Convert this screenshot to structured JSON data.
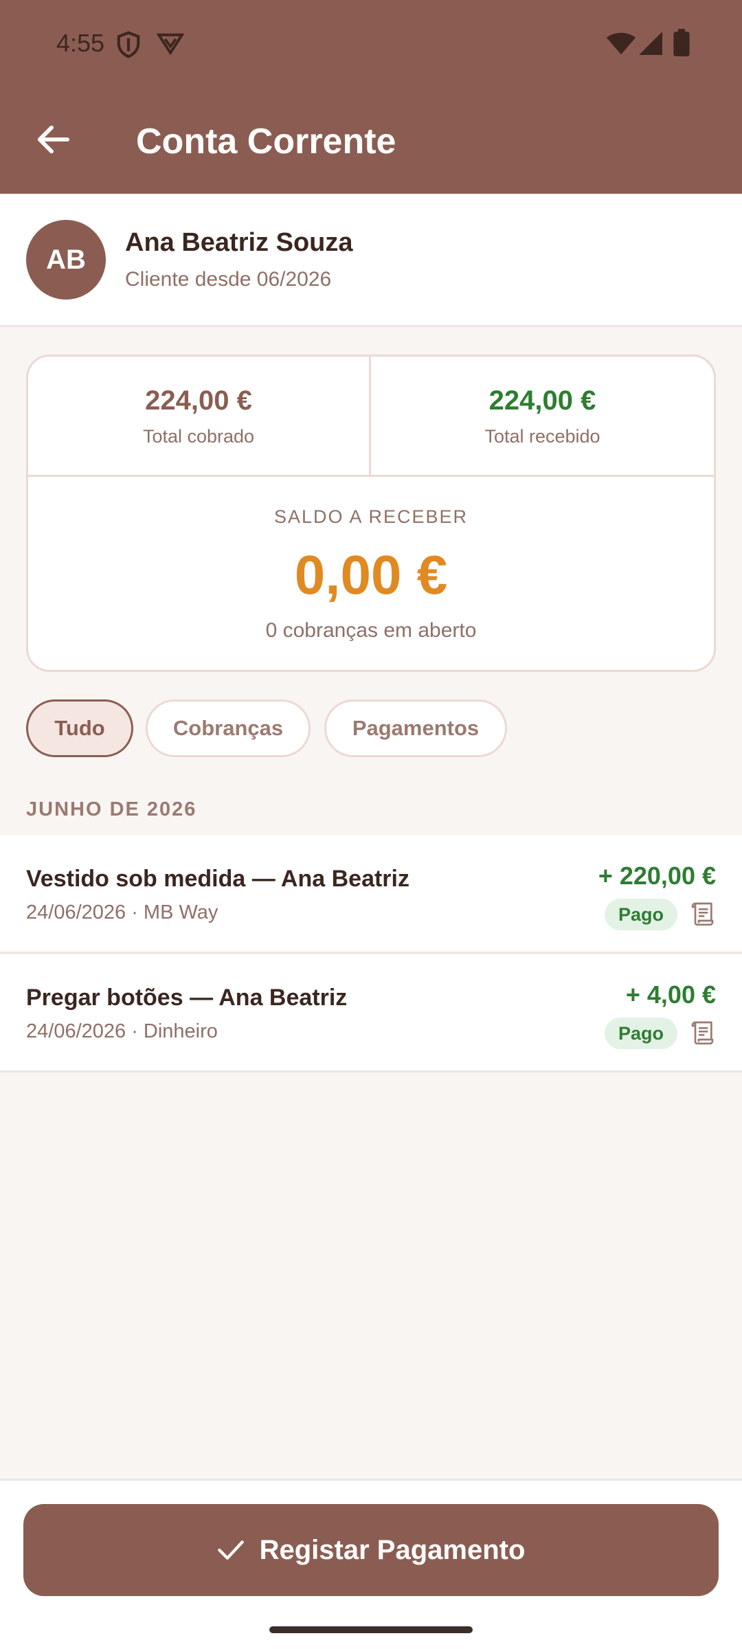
{
  "status_bar": {
    "time": "4:55",
    "icons": [
      "shield-icon",
      "vpn-icon",
      "wifi-icon",
      "signal-icon",
      "battery-icon"
    ]
  },
  "header": {
    "title": "Conta Corrente",
    "back_icon": "arrow-left-icon"
  },
  "client": {
    "initials": "AB",
    "name": "Ana Beatriz Souza",
    "since": "Cliente desde 06/2026"
  },
  "summary": {
    "charged_amount": "224,00 €",
    "charged_label": "Total cobrado",
    "received_amount": "224,00 €",
    "received_label": "Total recebido",
    "balance_label": "SALDO A RECEBER",
    "balance_amount": "0,00 €",
    "balance_sub": "0 cobranças em aberto"
  },
  "filters": [
    {
      "label": "Tudo",
      "active": true
    },
    {
      "label": "Cobranças",
      "active": false
    },
    {
      "label": "Pagamentos",
      "active": false
    }
  ],
  "section": {
    "title": "JUNHO DE 2026"
  },
  "transactions": [
    {
      "title": "Vestido sob medida — Ana Beatriz",
      "subtitle": "24/06/2026 · MB Way",
      "amount": "+ 220,00 €",
      "status": "Pago",
      "icon": "receipt-icon"
    },
    {
      "title": "Pregar botões — Ana Beatriz",
      "subtitle": "24/06/2026 · Dinheiro",
      "amount": "+ 4,00 €",
      "status": "Pago",
      "icon": "receipt-icon"
    }
  ],
  "footer": {
    "button_label": "Registar Pagamento",
    "button_icon": "check-icon"
  },
  "colors": {
    "primary": "#8b5d52",
    "positive": "#2e7d32",
    "balance": "#e08a23",
    "background": "#f9f5f2"
  }
}
